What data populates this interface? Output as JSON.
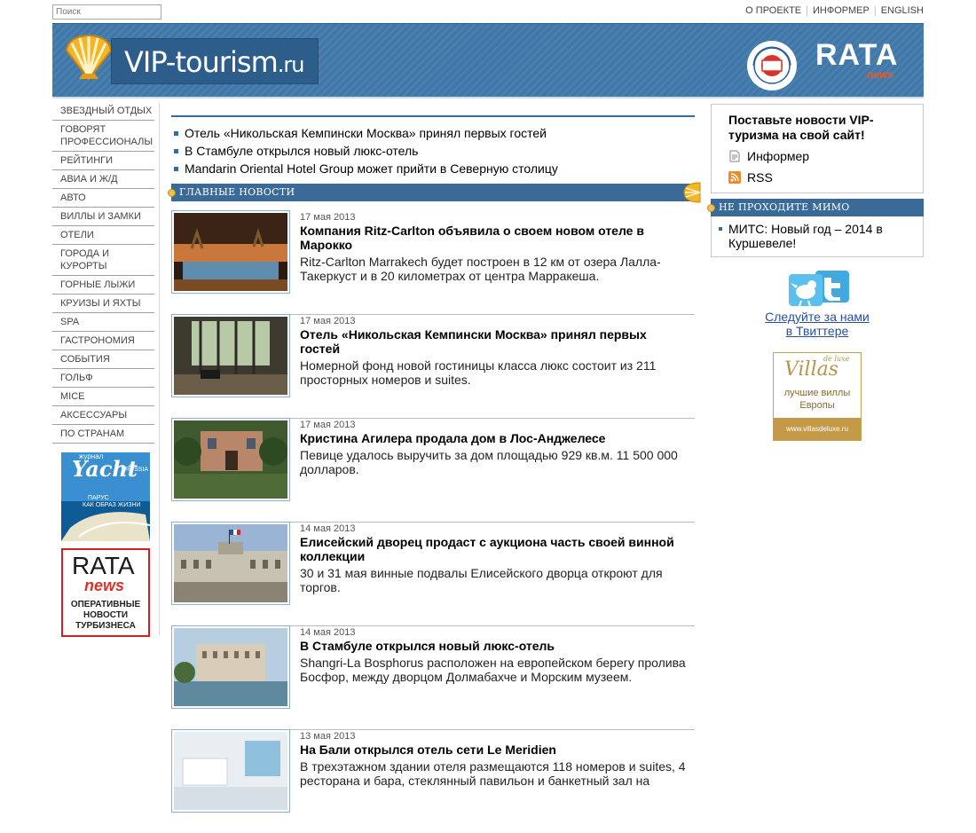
{
  "search": {
    "placeholder": "Поиск"
  },
  "toplinks": [
    "О ПРОЕКТЕ",
    "ИНФОРМЕР",
    "ENGLISH"
  ],
  "banner": {
    "site_name": "VIP-tourism",
    "site_tld": ".ru",
    "rata": "RATA",
    "rata_news": "news",
    "emblem_text": "Российский союз туриндустрии"
  },
  "sidebar": {
    "items": [
      "ЗВЕЗДНЫЙ ОТДЫХ",
      "ГОВОРЯТ ПРОФЕССИОНАЛЫ",
      "РЕЙТИНГИ",
      "АВИА И Ж/Д",
      "АВТО",
      "ВИЛЛЫ И ЗАМКИ",
      "ОТЕЛИ",
      "ГОРОДА И КУРОРТЫ",
      "ГОРНЫЕ ЛЫЖИ",
      "КРУИЗЫ И ЯХТЫ",
      "SPA",
      "ГАСТРОНОМИЯ",
      "СОБЫТИЯ",
      "ГОЛЬФ",
      "MICE",
      "АКСЕССУАРЫ",
      "ПО СТРАНАМ"
    ],
    "ad_yacht": {
      "journal": "журнал",
      "title": "Yacht",
      "sub": "RUSSIA",
      "tagline1": "ПАРУС",
      "tagline2": "КАК ОБРАЗ ЖИЗНИ"
    },
    "ad_rata": {
      "title": "RATA",
      "news": "news",
      "line1": "ОПЕРАТИВНЫЕ",
      "line2": "НОВОСТИ",
      "line3": "ТУРБИЗНЕСА"
    }
  },
  "top_news": [
    "Отель «Никольская Кемпински Москва» принял первых гостей",
    "В Стамбуле открылся новый люкс-отель",
    "Mandarin Oriental Hotel Group может прийти в Северную столицу"
  ],
  "main_section": {
    "label": "ГЛАВНЫЕ НОВОСТИ"
  },
  "news": [
    {
      "date": "17 мая 2013",
      "title": "Компания Ritz-Carlton объявила о своем новом отеле в Марокко",
      "desc": "Ritz-Carlton Marrakech будет построен в 12 км от озера Лалла-Такеркуст и в 20 километрах от центра Марракеша."
    },
    {
      "date": "17 мая 2013",
      "title": "Отель «Никольская Кемпински Москва» принял первых гостей",
      "desc": "Номерной фонд новой гостиницы класса люкс состоит из 211 просторных номеров и suites."
    },
    {
      "date": "17 мая 2013",
      "title": "Кристина Агилера продала дом в Лос-Анджелесе",
      "desc": "Певице удалось выручить за дом площадью 929 кв.м. 11 500 000 долларов."
    },
    {
      "date": "14 мая 2013",
      "title": "Елисейский дворец продаст с аукциона часть своей винной коллекции",
      "desc": "30 и 31 мая винные подвалы Елисейского дворца откроют для торгов."
    },
    {
      "date": "14 мая 2013",
      "title": "В Стамбуле открылся новый люкс-отель",
      "desc": "Shangri-La Bosphorus расположен на европейском берегу пролива Босфор, между дворцом Долмабахче и Морским музеем."
    },
    {
      "date": "13 мая 2013",
      "title": "На Бали открылся отель сети Le Meridien",
      "desc": "В трехэтажном здании отеля размещаются 118 номеров и suites, 4 ресторана и бара, стеклянный павильон и банкетный зал на"
    }
  ],
  "right": {
    "promo_title": "Поставьте новости VIP-туризма на свой сайт!",
    "informer": "Информер",
    "rss": "RSS",
    "section_label": "НЕ ПРОХОДИТЕ МИМО",
    "item": "МИТС: Новый год – 2014 в Куршевеле!",
    "twitter_line1": "Следуйте за нами",
    "twitter_line2": "в Твиттере",
    "villas": {
      "brand": "Villas",
      "deluxe": "de luxe",
      "line1": "лучшие виллы",
      "line2": "Европы",
      "url": "www.villasdeluxe.ru"
    }
  }
}
